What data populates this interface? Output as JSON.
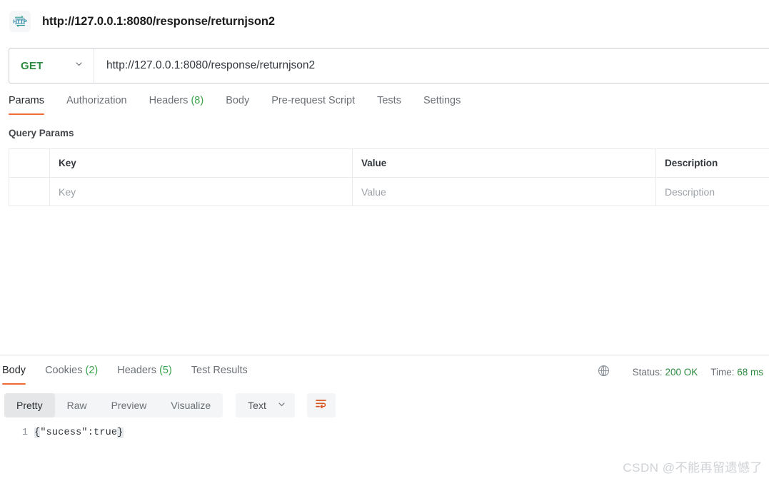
{
  "titlebar": {
    "icon": "http-protocol-icon",
    "title": "http://127.0.0.1:8080/response/returnjson2"
  },
  "request": {
    "method": "GET",
    "method_color": "#2b8a3e",
    "method_chevron": "chevron-down-icon",
    "url": "http://127.0.0.1:8080/response/returnjson2",
    "url_placeholder": "Enter request URL",
    "tabs": [
      {
        "label": "Params",
        "count": "",
        "active": true
      },
      {
        "label": "Authorization",
        "count": "",
        "active": false
      },
      {
        "label": "Headers",
        "count": "(8)",
        "active": false
      },
      {
        "label": "Body",
        "count": "",
        "active": false
      },
      {
        "label": "Pre-request Script",
        "count": "",
        "active": false
      },
      {
        "label": "Tests",
        "count": "",
        "active": false
      },
      {
        "label": "Settings",
        "count": "",
        "active": false
      }
    ],
    "active_tab_underline_color": "#ef6c36",
    "count_color": "#3aa34a"
  },
  "query_params": {
    "section_title": "Query Params",
    "columns": [
      "",
      "Key",
      "Value",
      "Description"
    ],
    "rows": [
      {
        "check": "",
        "key_placeholder": "Key",
        "value_placeholder": "Value",
        "description_placeholder": "Description"
      }
    ]
  },
  "response": {
    "tabs": [
      {
        "label": "Body",
        "count": "",
        "active": true
      },
      {
        "label": "Cookies",
        "count": "(2)",
        "active": false
      },
      {
        "label": "Headers",
        "count": "(5)",
        "active": false
      },
      {
        "label": "Test Results",
        "count": "",
        "active": false
      }
    ],
    "status": {
      "globe_icon": "globe-icon",
      "status_label": "Status:",
      "status_value": "200 OK",
      "time_label": "Time:",
      "time_value": "68 ms",
      "value_color": "#2b8a3e"
    },
    "view_modes": [
      {
        "label": "Pretty",
        "active": true
      },
      {
        "label": "Raw",
        "active": false
      },
      {
        "label": "Preview",
        "active": false
      },
      {
        "label": "Visualize",
        "active": false
      }
    ],
    "format": {
      "selected": "Text",
      "chevron": "chevron-down-icon"
    },
    "wrap_button": {
      "icon": "word-wrap-icon",
      "color": "#d9551f"
    },
    "body": {
      "line_number": "1",
      "open_brace": "{",
      "content": "\"sucess\":true",
      "close_brace": "}"
    }
  },
  "watermark": {
    "text": "CSDN @不能再留遗憾了"
  }
}
